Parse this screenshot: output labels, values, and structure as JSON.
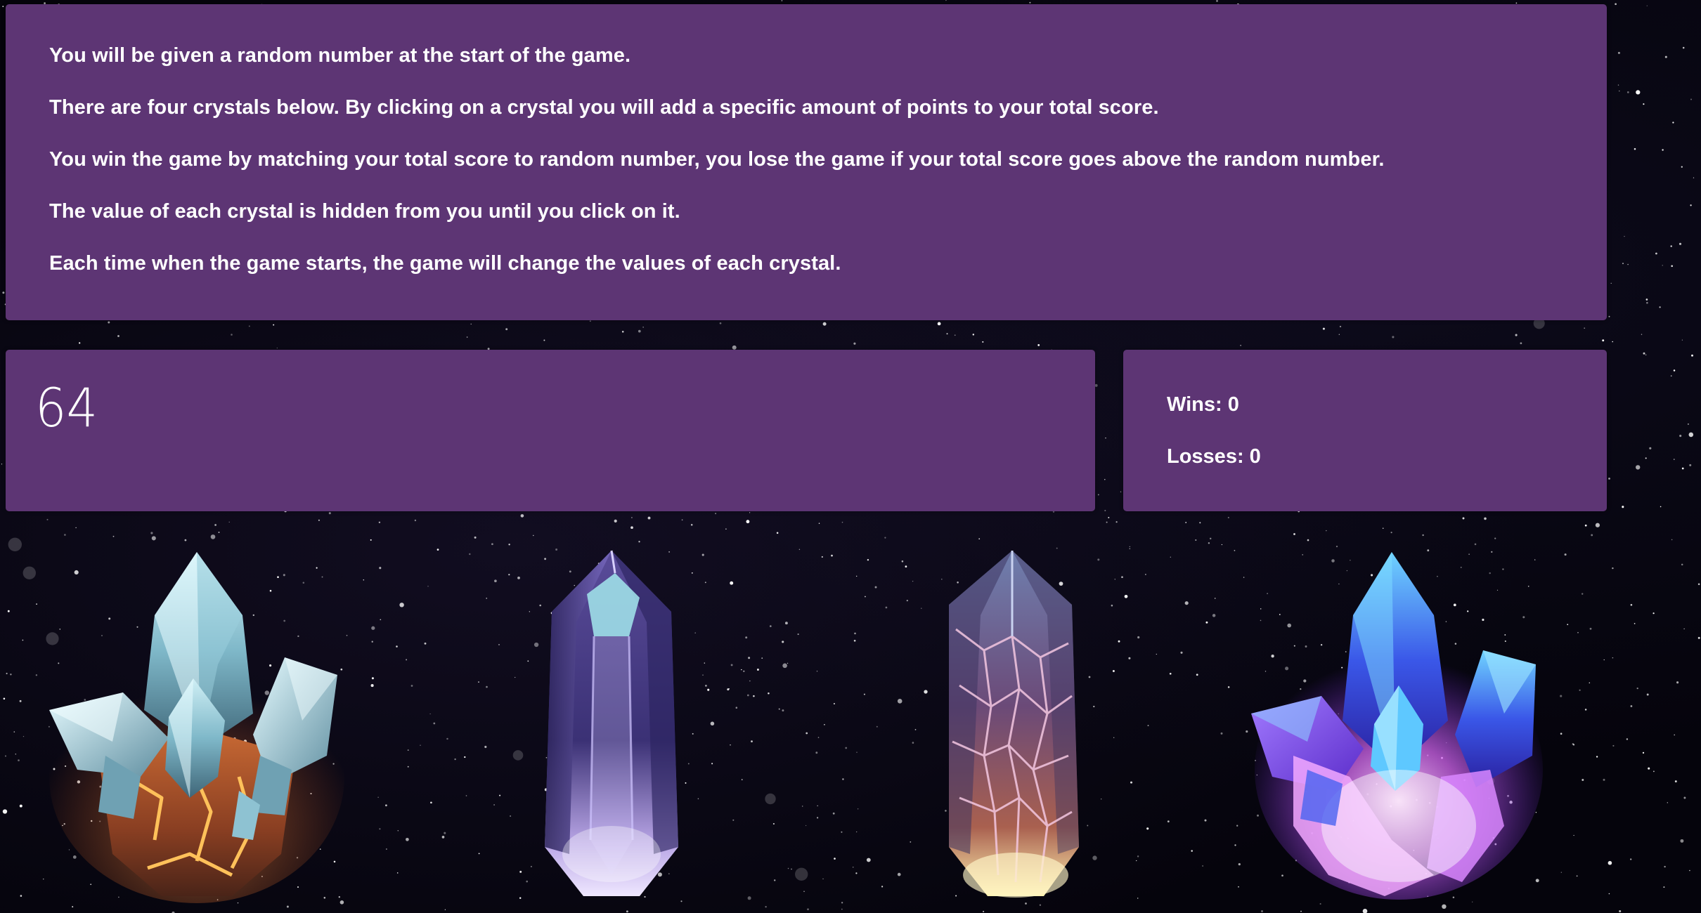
{
  "instructions": {
    "lines": [
      "You will be given a random number at the start of the game.",
      "There are four crystals below. By clicking on a crystal you will add a specific amount of points to your total score.",
      "You win the game by matching your total score to random number, you lose the game if your total score goes above the random number.",
      "The value of each crystal is hidden from you until you click on it.",
      "Each time when the game starts, the game will change the values of each crystal."
    ]
  },
  "game": {
    "random_number": "64",
    "wins_label": "Wins: ",
    "wins": "0",
    "losses_label": "Losses: ",
    "losses": "0"
  },
  "crystals": [
    {
      "icon": "orange-lava-crystal-cluster-icon"
    },
    {
      "icon": "clear-violet-crystal-icon"
    },
    {
      "icon": "cracked-pink-crystal-icon"
    },
    {
      "icon": "glowing-purple-crystal-cluster-icon"
    }
  ],
  "colors": {
    "panel": "#5d3574",
    "background": "#05040c",
    "text": "#ffffff"
  }
}
